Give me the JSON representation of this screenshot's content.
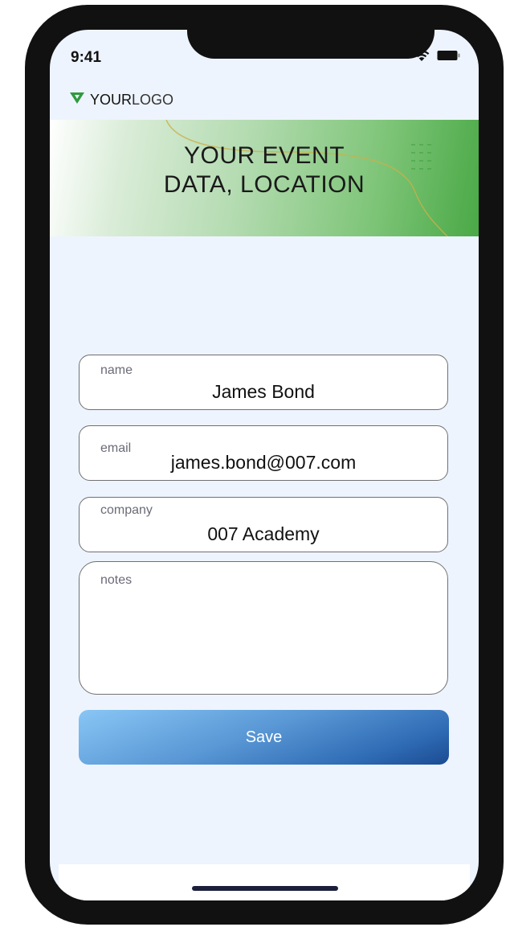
{
  "status_bar": {
    "time": "9:41",
    "icons": [
      "wifi-icon",
      "battery-icon"
    ]
  },
  "logo": {
    "bold": "YOUR",
    "light": "LOGO",
    "icon": "logo-v-icon",
    "icon_color": "#2f9a3e"
  },
  "banner": {
    "line1": "YOUR EVENT",
    "line2": "DATA, LOCATION"
  },
  "form": {
    "name": {
      "label": "name",
      "value": "James Bond"
    },
    "email": {
      "label": "email",
      "value": "james.bond@007.com"
    },
    "company": {
      "label": "company",
      "value": "007 Academy"
    },
    "notes": {
      "label": "notes",
      "value": ""
    }
  },
  "save_button": {
    "label": "Save"
  },
  "colors": {
    "screen_bg": "#eef4fd",
    "banner_green": "#4aa946",
    "button_blue": "#1b4b92",
    "button_light": "#89c6f5"
  }
}
